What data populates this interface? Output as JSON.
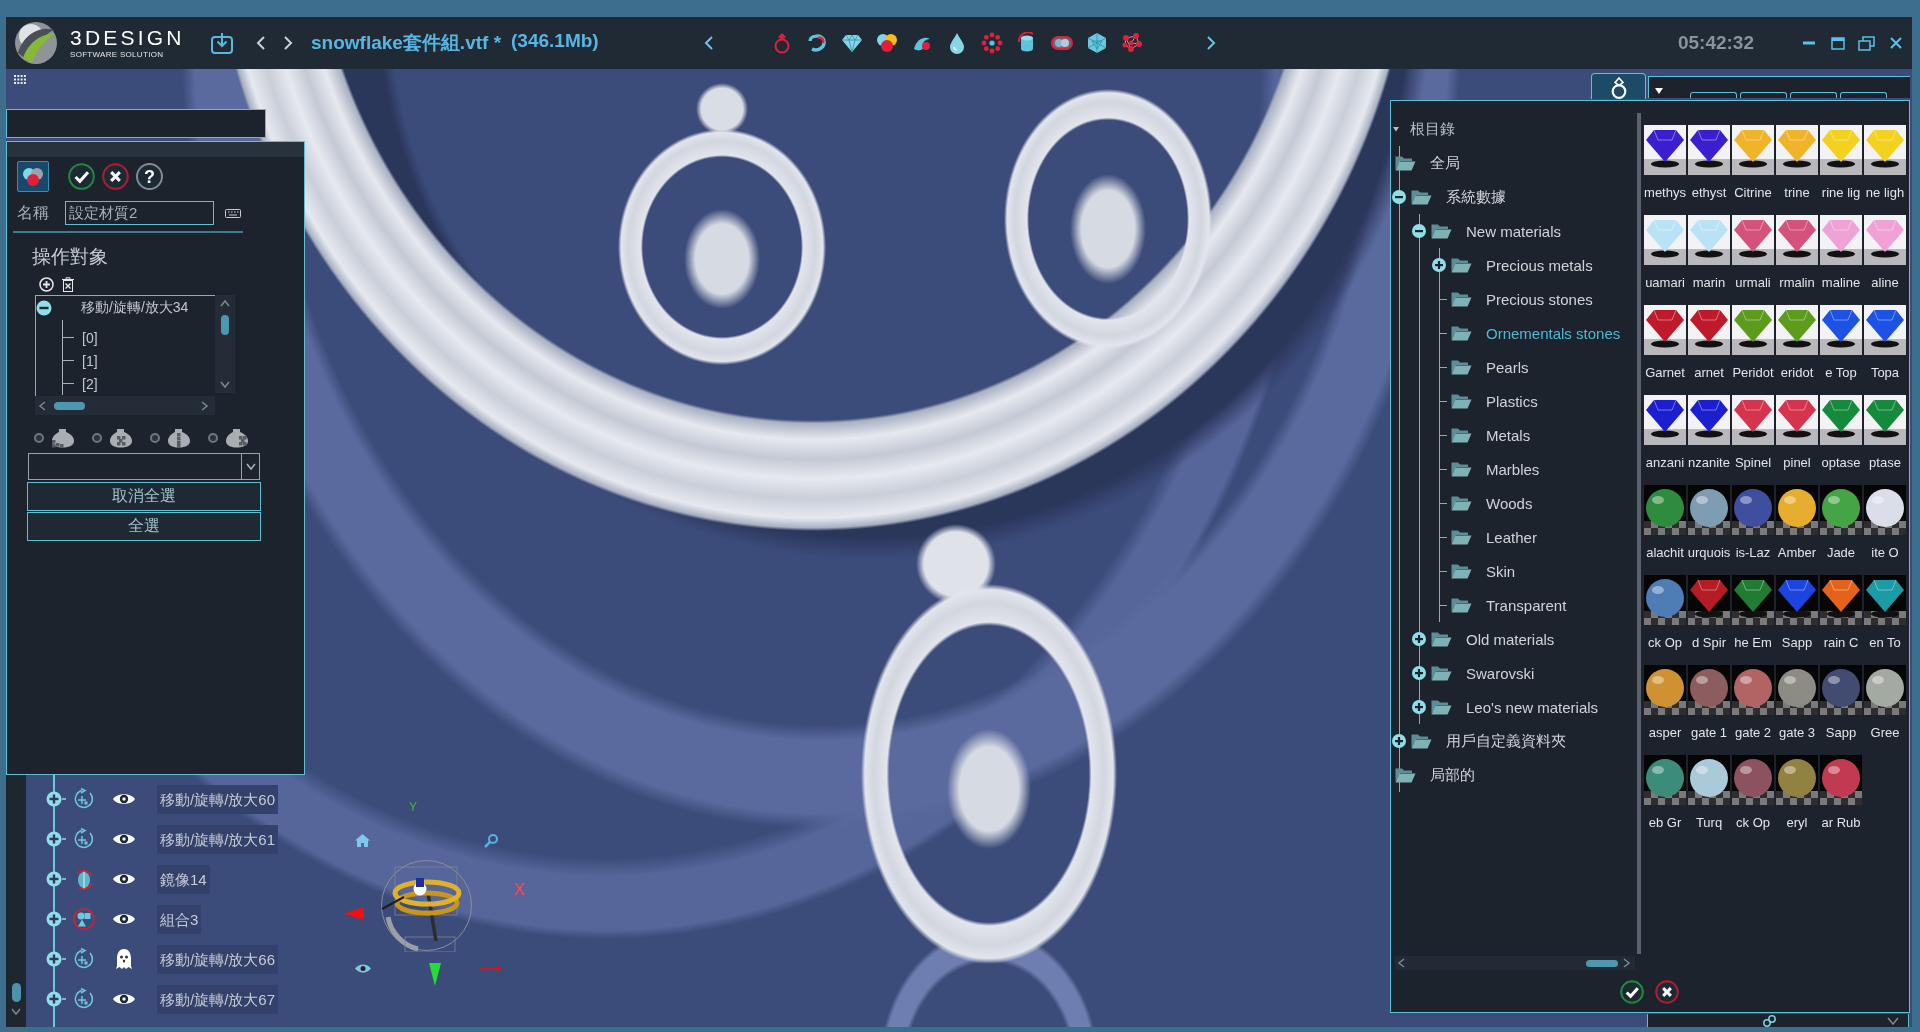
{
  "title_bar": {
    "logo_wordmark": "3DESIGN",
    "logo_tagline": "SOFTWARE SOLUTION",
    "file_name": "snowflake套件組.vtf *",
    "file_size": "(346.1Mb)",
    "clock": "05:42:32"
  },
  "material_panel": {
    "help_label": "?",
    "name_label": "名稱",
    "name_value": "設定材質2",
    "targets_heading": "操作對象",
    "targets": [
      {
        "label": "移動/旋轉/放大34",
        "expanded": true,
        "children": [
          {
            "label": "[0]"
          },
          {
            "label": "[1]"
          },
          {
            "label": "[2]"
          }
        ]
      }
    ],
    "mapping_options": [
      {
        "kind": "planar",
        "selected": false
      },
      {
        "kind": "spherical",
        "selected": false
      },
      {
        "kind": "cylindrical",
        "selected": false
      },
      {
        "kind": "box",
        "selected": false
      }
    ],
    "buttons": [
      "取消全選",
      "全選"
    ]
  },
  "scene_tree": [
    {
      "label": "移動/旋轉/放大60",
      "kind": "transform",
      "expanded": false,
      "visible": true
    },
    {
      "label": "移動/旋轉/放大61",
      "kind": "transform",
      "expanded": false,
      "visible": true
    },
    {
      "label": "鏡像14",
      "kind": "mirror",
      "expanded": false,
      "visible": true
    },
    {
      "label": "組合3",
      "kind": "group",
      "expanded": false,
      "visible": true
    },
    {
      "label": "移動/旋轉/放大66",
      "kind": "transform",
      "expanded": false,
      "visible": false
    },
    {
      "label": "移動/旋轉/放大67",
      "kind": "transform",
      "expanded": false,
      "visible": true
    }
  ],
  "view_gizmo": {
    "y_label": "Y",
    "x_label": "X"
  },
  "library_tree": [
    {
      "label": "根目錄",
      "expanded": true,
      "selected": false,
      "children": [
        {
          "label": "全局",
          "selected": false
        },
        {
          "label": "系統數據",
          "expanded": true,
          "selected": false,
          "children": [
            {
              "label": "New materials",
              "expanded": true,
              "selected": false,
              "children": [
                {
                  "label": "Precious metals",
                  "expanded": false,
                  "selected": false
                },
                {
                  "label": "Precious stones",
                  "selected": false
                },
                {
                  "label": "Ornementals stones",
                  "selected": true
                },
                {
                  "label": "Pearls",
                  "selected": false
                },
                {
                  "label": "Plastics",
                  "selected": false
                },
                {
                  "label": "Metals",
                  "selected": false
                },
                {
                  "label": "Marbles",
                  "selected": false
                },
                {
                  "label": "Woods",
                  "selected": false
                },
                {
                  "label": "Leather",
                  "selected": false
                },
                {
                  "label": "Skin",
                  "selected": false
                },
                {
                  "label": "Transparent",
                  "selected": false
                }
              ]
            },
            {
              "label": "Old materials",
              "expanded": false,
              "selected": false
            },
            {
              "label": "Swarovski",
              "expanded": false,
              "selected": false
            },
            {
              "label": "Leo's new materials",
              "expanded": false,
              "selected": false
            }
          ]
        },
        {
          "label": "用戶自定義資料夾",
          "expanded": false,
          "selected": false
        },
        {
          "label": "局部的",
          "selected": false
        }
      ]
    }
  ],
  "materials": [
    {
      "label": "methys",
      "color": "#3b1fcf",
      "kind": "gem"
    },
    {
      "label": "ethyst",
      "color": "#3b1fcf",
      "kind": "gem"
    },
    {
      "label": "Citrine",
      "color": "#efb42a",
      "kind": "gem"
    },
    {
      "label": "trine",
      "color": "#efb42a",
      "kind": "gem"
    },
    {
      "label": "rine lig",
      "color": "#f2d21e",
      "kind": "gem"
    },
    {
      "label": "ne ligh",
      "color": "#f2d21e",
      "kind": "gem"
    },
    {
      "label": "uamari",
      "color": "#b9e3f4",
      "kind": "gem"
    },
    {
      "label": "marin",
      "color": "#b9e3f4",
      "kind": "gem"
    },
    {
      "label": "urmali",
      "color": "#d4527c",
      "kind": "gem"
    },
    {
      "label": "rmalin",
      "color": "#d4527c",
      "kind": "gem"
    },
    {
      "label": "maline",
      "color": "#f0a2d6",
      "kind": "gem"
    },
    {
      "label": "aline",
      "color": "#f0a2d6",
      "kind": "gem"
    },
    {
      "label": "Garnet",
      "color": "#bf1a2c",
      "kind": "gem"
    },
    {
      "label": "arnet",
      "color": "#bf1a2c",
      "kind": "gem"
    },
    {
      "label": "Peridot",
      "color": "#5c9b1c",
      "kind": "gem"
    },
    {
      "label": "eridot",
      "color": "#5c9b1c",
      "kind": "gem"
    },
    {
      "label": "e Top",
      "color": "#1d52e6",
      "kind": "gem"
    },
    {
      "label": "Topa",
      "color": "#1d52e6",
      "kind": "gem"
    },
    {
      "label": "anzani",
      "color": "#1c1fcf",
      "kind": "gem"
    },
    {
      "label": "nzanite",
      "color": "#1c1fcf",
      "kind": "gem"
    },
    {
      "label": "Spinel",
      "color": "#d6334f",
      "kind": "gem"
    },
    {
      "label": "pinel",
      "color": "#d6334f",
      "kind": "gem"
    },
    {
      "label": "optase",
      "color": "#158a3c",
      "kind": "gem"
    },
    {
      "label": "ptase",
      "color": "#158a3c",
      "kind": "gem"
    },
    {
      "label": "alachit",
      "color": "#2e8c3e",
      "kind": "sphere"
    },
    {
      "label": "urquois",
      "color": "#7f9db2",
      "kind": "sphere"
    },
    {
      "label": "is-Laz",
      "color": "#3d4f9e",
      "kind": "sphere"
    },
    {
      "label": "Amber",
      "color": "#e6ad2e",
      "kind": "sphere"
    },
    {
      "label": "Jade",
      "color": "#45a545",
      "kind": "sphere"
    },
    {
      "label": "ite O",
      "color": "#d9dee8",
      "kind": "sphere"
    },
    {
      "label": "ck Op",
      "color": "#4d7db4",
      "kind": "sphere"
    },
    {
      "label": "d Spir",
      "color": "#b51c24",
      "kind": "dark_gem"
    },
    {
      "label": "he Em",
      "color": "#207c32",
      "kind": "dark_gem"
    },
    {
      "label": "Sapp",
      "color": "#1c44df",
      "kind": "dark_gem"
    },
    {
      "label": "rain C",
      "color": "#e5621a",
      "kind": "dark_gem"
    },
    {
      "label": "en To",
      "color": "#1c9aa6",
      "kind": "dark_gem"
    },
    {
      "label": "asper",
      "color": "#cf9232",
      "kind": "sphere"
    },
    {
      "label": "gate 1",
      "color": "#8c5c5e",
      "kind": "sphere"
    },
    {
      "label": "gate 2",
      "color": "#b26464",
      "kind": "sphere"
    },
    {
      "label": "gate 3",
      "color": "#8c8c84",
      "kind": "sphere"
    },
    {
      "label": "Sapp",
      "color": "#424c72",
      "kind": "sphere"
    },
    {
      "label": "Gree",
      "color": "#a2aaa2",
      "kind": "sphere"
    },
    {
      "label": "eb Gr",
      "color": "#3c8c7a",
      "kind": "sphere"
    },
    {
      "label": "Turq",
      "color": "#aacada",
      "kind": "sphere"
    },
    {
      "label": "ck Op",
      "color": "#8c5260",
      "kind": "sphere"
    },
    {
      "label": "eryl",
      "color": "#928242",
      "kind": "sphere"
    },
    {
      "label": "ar Rub",
      "color": "#c23a52",
      "kind": "sphere"
    }
  ]
}
